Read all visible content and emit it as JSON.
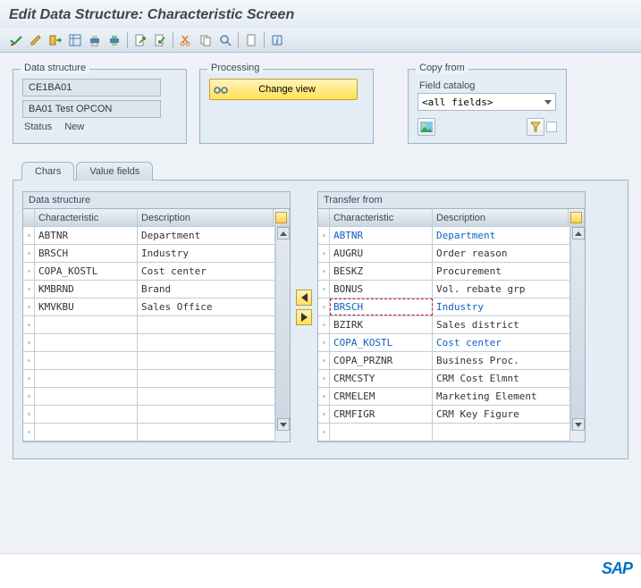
{
  "title": "Edit Data Structure: Characteristic Screen",
  "toolbar_icons": [
    "check",
    "pencil",
    "toggle",
    "table-settings",
    "print",
    "print-grid",
    "export",
    "export-plus",
    "find",
    "cut",
    "copy",
    "search",
    "blank-doc",
    "info"
  ],
  "panels": {
    "data_structure": {
      "title": "Data structure",
      "code": "CE1BA01",
      "name": "BA01 Test OPCON",
      "status_label": "Status",
      "status_value": "New"
    },
    "processing": {
      "title": "Processing",
      "change_view_label": "Change view"
    },
    "copy_from": {
      "title": "Copy from",
      "subtitle": "Field catalog",
      "value": "<all fields>"
    }
  },
  "tabs": {
    "chars": "Chars",
    "value_fields": "Value fields"
  },
  "left_table": {
    "title": "Data structure",
    "col1": "Characteristic",
    "col2": "Description",
    "rows": [
      {
        "c": "ABTNR",
        "d": "Department"
      },
      {
        "c": "BRSCH",
        "d": "Industry"
      },
      {
        "c": "COPA_KOSTL",
        "d": "Cost center"
      },
      {
        "c": "KMBRND",
        "d": "Brand"
      },
      {
        "c": "KMVKBU",
        "d": "Sales Office"
      }
    ]
  },
  "right_table": {
    "title": "Transfer from",
    "col1": "Characteristic",
    "col2": "Description",
    "rows": [
      {
        "c": "ABTNR",
        "d": "Department",
        "blue": true
      },
      {
        "c": "AUGRU",
        "d": "Order reason"
      },
      {
        "c": "BESKZ",
        "d": "Procurement"
      },
      {
        "c": "BONUS",
        "d": "Vol. rebate grp"
      },
      {
        "c": "BRSCH",
        "d": "Industry",
        "blue": true,
        "focus": true
      },
      {
        "c": "BZIRK",
        "d": "Sales district"
      },
      {
        "c": "COPA_KOSTL",
        "d": "Cost center",
        "blue": true
      },
      {
        "c": "COPA_PRZNR",
        "d": "Business Proc."
      },
      {
        "c": "CRMCSTY",
        "d": "CRM Cost Elmnt"
      },
      {
        "c": "CRMELEM",
        "d": "Marketing Element"
      },
      {
        "c": "CRMFIGR",
        "d": "CRM Key Figure"
      }
    ]
  },
  "footer_logo": "SAP"
}
